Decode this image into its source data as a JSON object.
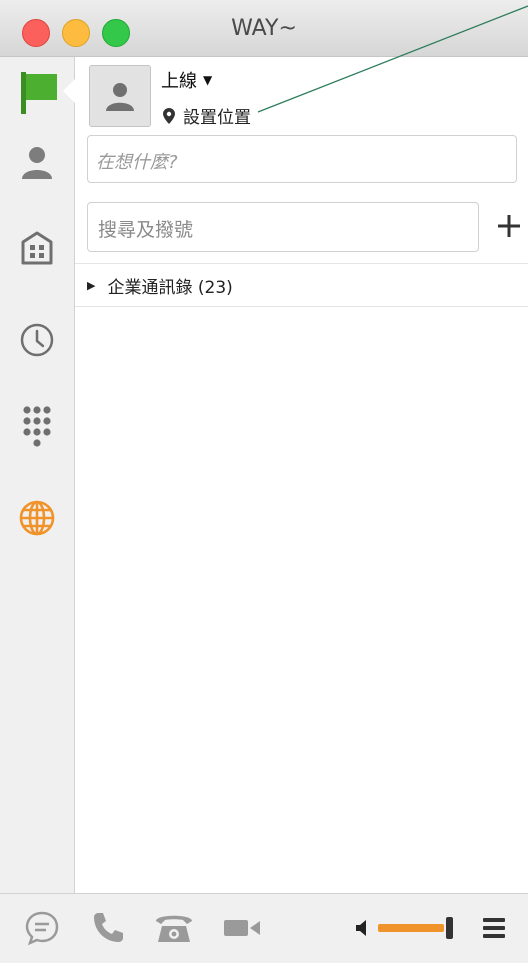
{
  "window": {
    "title": "WAY~"
  },
  "sidebar": {
    "items": [
      {
        "icon": "flag-icon",
        "active": true
      },
      {
        "icon": "contacts-icon"
      },
      {
        "icon": "company-directory-icon"
      },
      {
        "icon": "clock-history-icon"
      },
      {
        "icon": "dialpad-icon"
      },
      {
        "icon": "globe-icon"
      }
    ]
  },
  "profile": {
    "status": "上線",
    "location": "設置位置"
  },
  "mood": {
    "placeholder": "在想什麼?"
  },
  "search": {
    "placeholder": "搜尋及撥號"
  },
  "directory": {
    "label": "企業通訊錄 (23)"
  },
  "bottom": {
    "icons": [
      "chat-icon",
      "phone-icon",
      "desk-phone-icon",
      "video-icon",
      "speaker-icon",
      "menu-icon"
    ],
    "volume_level": 1.0
  },
  "colors": {
    "accent_green": "#4caf2f",
    "accent_orange": "#f0932b",
    "icon_gray": "#8a8a8a"
  }
}
